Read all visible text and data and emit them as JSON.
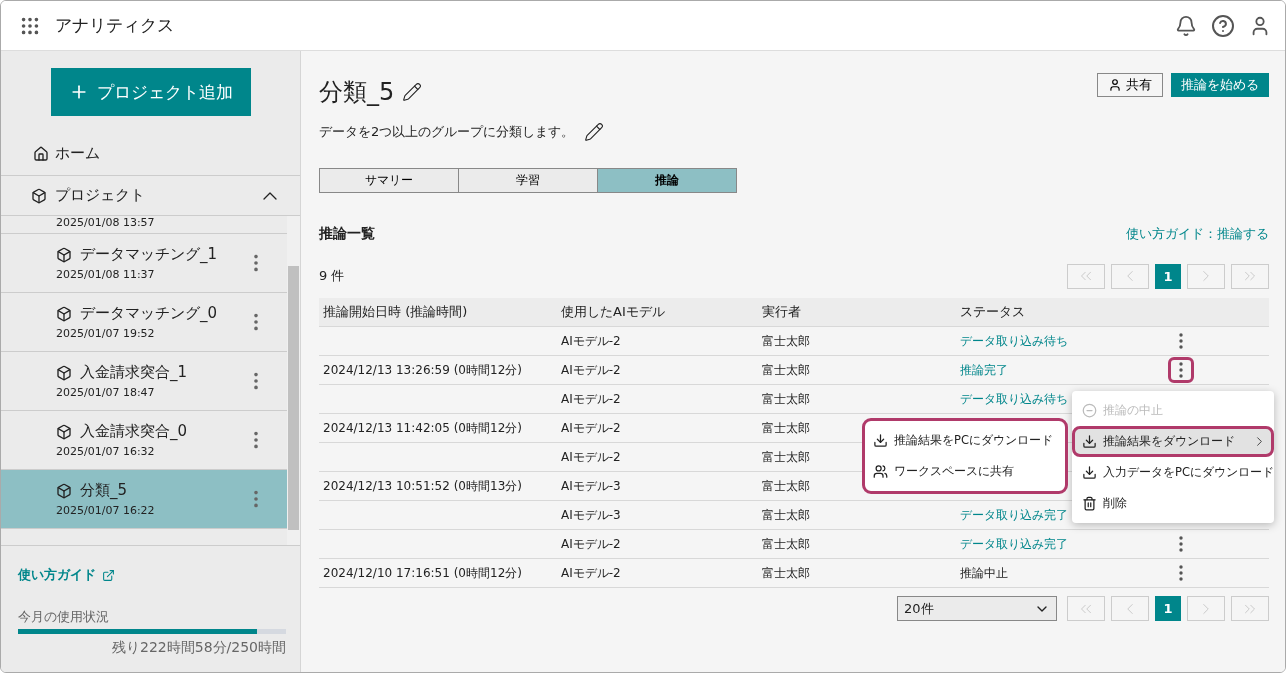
{
  "app": {
    "title": "アナリティクス"
  },
  "sidebar": {
    "add_button": "プロジェクト追加",
    "home": "ホーム",
    "projects_label": "プロジェクト",
    "projects_expanded": true,
    "projects": [
      {
        "date": "2025/01/08 13:57",
        "selected": false
      },
      {
        "name": "データマッチング_1",
        "date": "2025/01/08 11:37",
        "selected": false
      },
      {
        "name": "データマッチング_0",
        "date": "2025/01/07 19:52",
        "selected": false
      },
      {
        "name": "入金請求突合_1",
        "date": "2025/01/07 18:47",
        "selected": false
      },
      {
        "name": "入金請求突合_0",
        "date": "2025/01/07 16:32",
        "selected": false
      },
      {
        "name": "分類_5",
        "date": "2025/01/07 16:22",
        "selected": true
      }
    ],
    "guide_link": "使い方ガイド",
    "usage_label": "今月の使用状況",
    "usage": {
      "level": 0.89
    },
    "usage_text": "残り222時間58分/250時間"
  },
  "header": {
    "title": "分類_5",
    "description": "データを2つ以上のグループに分類します。",
    "share_button": "共有",
    "start_button": "推論を始める"
  },
  "tabs": [
    {
      "label": "サマリー",
      "selected": false
    },
    {
      "label": "学習",
      "selected": false
    },
    {
      "label": "推論",
      "selected": true
    }
  ],
  "section": {
    "title": "推論一覧",
    "guide_link": "使い方ガイド：推論する",
    "count": "9 件"
  },
  "top_pagination": {
    "pages": [
      {
        "label": "1",
        "selected": true
      }
    ]
  },
  "bottom_pagination": {
    "page_size": "20件",
    "pages": [
      {
        "label": "1",
        "selected": true
      }
    ]
  },
  "table": {
    "columns": [
      "推論開始日時 (推論時間)",
      "使用したAIモデル",
      "実行者",
      "ステータス"
    ],
    "rows": [
      {
        "start": "",
        "model": "AIモデル-2",
        "user": "富士太郎",
        "status": "データ取り込み待ち",
        "status_link": true,
        "menu_open": false
      },
      {
        "start": "2024/12/13 13:26:59 (0時間12分)",
        "model": "AIモデル-2",
        "user": "富士太郎",
        "status": "推論完了",
        "status_link": true,
        "menu_open": true
      },
      {
        "start": "",
        "model": "AIモデル-2",
        "user": "富士太郎",
        "status": "データ取り込み待ち",
        "status_link": true
      },
      {
        "start": "2024/12/13 11:42:05 (0時間12分)",
        "model": "AIモデル-2",
        "user": "富士太郎"
      },
      {
        "start": "",
        "model": "AIモデル-2",
        "user": "富士太郎"
      },
      {
        "start": "2024/12/13 10:51:52 (0時間13分)",
        "model": "AIモデル-3",
        "user": "富士太郎"
      },
      {
        "start": "",
        "model": "AIモデル-3",
        "user": "富士太郎",
        "status": "データ取り込み完了",
        "status_link": true
      },
      {
        "start": "",
        "model": "AIモデル-2",
        "user": "富士太郎",
        "status": "データ取り込み完了",
        "status_link": true,
        "menu_open": false
      },
      {
        "start": "2024/12/10 17:16:51 (0時間12分)",
        "model": "AIモデル-2",
        "user": "富士太郎",
        "status": "推論中止",
        "status_link": false,
        "menu_open": false
      }
    ]
  },
  "context_menu": {
    "items": [
      {
        "label": "推論の中止",
        "kind": "stop",
        "disabled": true,
        "selected": false,
        "submenu": false
      },
      {
        "label": "推論結果をダウンロード",
        "kind": "download",
        "disabled": false,
        "selected": true,
        "submenu": true
      },
      {
        "label": "入力データをPCにダウンロード",
        "kind": "download",
        "disabled": false,
        "selected": false,
        "submenu": false
      },
      {
        "label": "削除",
        "kind": "delete",
        "disabled": false,
        "selected": false,
        "submenu": false
      }
    ]
  },
  "submenu": {
    "items": [
      {
        "label": "推論結果をPCにダウンロード",
        "kind": "download"
      },
      {
        "label": "ワークスペースに共有",
        "kind": "share"
      }
    ]
  }
}
